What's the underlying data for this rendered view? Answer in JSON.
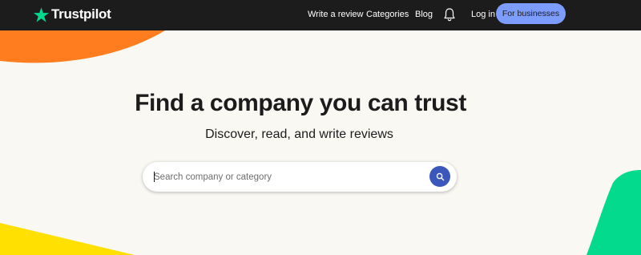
{
  "brand": {
    "name": "Trustpilot",
    "star_color": "#04da8d"
  },
  "nav": {
    "write_review": "Write a review",
    "categories": "Categories",
    "blog": "Blog",
    "notifications_icon": "bell-icon",
    "login": "Log in",
    "for_businesses": "For businesses"
  },
  "hero": {
    "title": "Find a company you can trust",
    "subtitle": "Discover, read, and write reviews"
  },
  "search": {
    "value": "",
    "placeholder": "Search company or category",
    "button_icon": "search-icon"
  },
  "colors": {
    "topbar": "#1c1c1c",
    "background": "#faf8f3",
    "business_button": "#7c9dff",
    "search_button": "#3c57bc",
    "deco_orange": "#ff7d1e",
    "deco_yellow": "#ffe000",
    "deco_green": "#04da8d"
  }
}
